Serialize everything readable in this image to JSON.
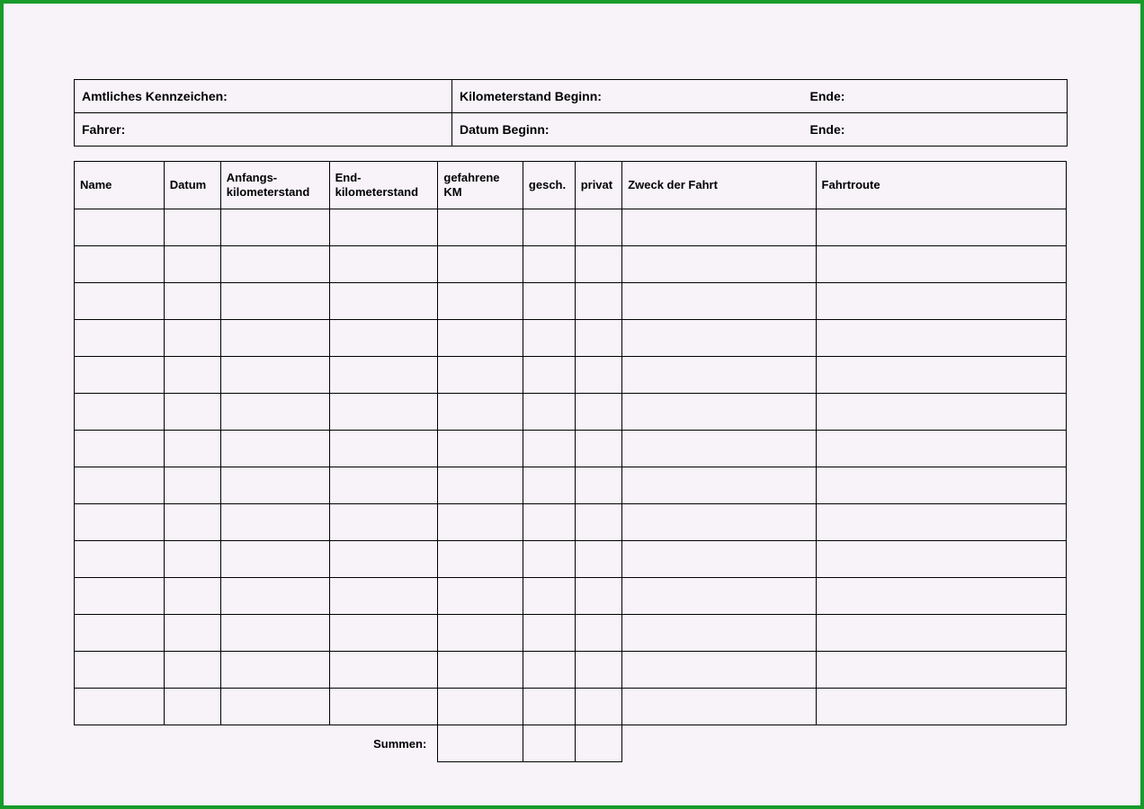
{
  "header": {
    "license_plate_label": "Amtliches Kennzeichen:",
    "km_begin_label": "Kilometerstand Beginn:",
    "km_end_label": "Ende:",
    "driver_label": "Fahrer:",
    "date_begin_label": "Datum Beginn:",
    "date_end_label": "Ende:"
  },
  "columns": {
    "name": "Name",
    "datum": "Datum",
    "anfang": "Anfangs-\nkilometerstand",
    "end": "End-\nkilometerstand",
    "km": "gefahrene KM",
    "gesch": "gesch.",
    "privat": "privat",
    "zweck": "Zweck der Fahrt",
    "route": "Fahrtroute"
  },
  "rows": [
    {},
    {},
    {},
    {},
    {},
    {},
    {},
    {},
    {},
    {},
    {},
    {},
    {},
    {}
  ],
  "sums_label": "Summen:"
}
